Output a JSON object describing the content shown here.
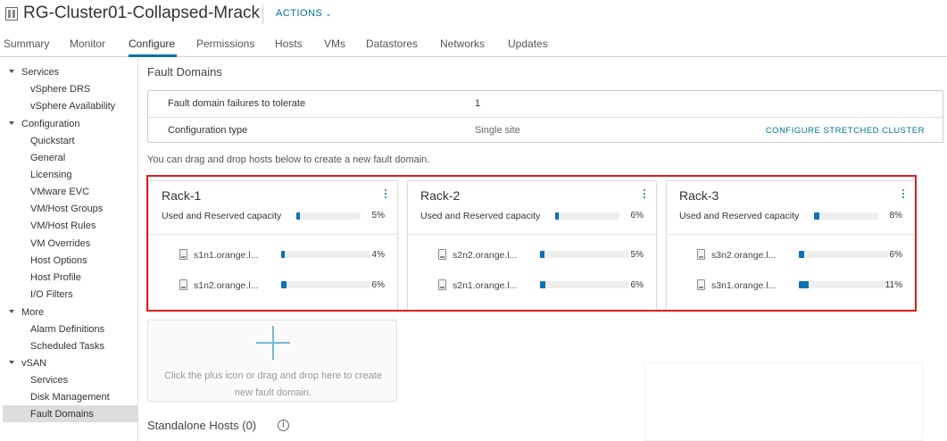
{
  "header": {
    "title": "RG-Cluster01-Collapsed-Mrack",
    "actions_label": "ACTIONS",
    "icon": "cluster-icon"
  },
  "tabs": [
    {
      "label": "Summary"
    },
    {
      "label": "Monitor"
    },
    {
      "label": "Configure",
      "active": true
    },
    {
      "label": "Permissions"
    },
    {
      "label": "Hosts"
    },
    {
      "label": "VMs"
    },
    {
      "label": "Datastores"
    },
    {
      "label": "Networks"
    },
    {
      "label": "Updates"
    }
  ],
  "sidebar": {
    "groups": [
      {
        "label": "Services",
        "items": [
          "vSphere DRS",
          "vSphere Availability"
        ]
      },
      {
        "label": "Configuration",
        "items": [
          "Quickstart",
          "General",
          "Licensing",
          "VMware EVC",
          "VM/Host Groups",
          "VM/Host Rules",
          "VM Overrides",
          "Host Options",
          "Host Profile",
          "I/O Filters"
        ]
      },
      {
        "label": "More",
        "items": [
          "Alarm Definitions",
          "Scheduled Tasks"
        ]
      },
      {
        "label": "vSAN",
        "items": [
          "Services",
          "Disk Management",
          "Fault Domains"
        ]
      }
    ],
    "selected": "Fault Domains"
  },
  "main": {
    "title": "Fault Domains",
    "summary": [
      {
        "label": "Fault domain failures to tolerate",
        "value": "1"
      },
      {
        "label": "Configuration type",
        "value": "Single site",
        "link": "CONFIGURE STRETCHED CLUSTER"
      }
    ],
    "help_text": "You can drag and drop hosts below to create a new fault domain.",
    "capacity_label": "Used and Reserved capacity",
    "racks": [
      {
        "name": "Rack-1",
        "capacity_pct": 5,
        "capacity_text": "5%",
        "hosts": [
          {
            "name": "s1n1.orange.l...",
            "pct": 4,
            "pct_text": "4%"
          },
          {
            "name": "s1n2.orange.l...",
            "pct": 6,
            "pct_text": "6%"
          }
        ]
      },
      {
        "name": "Rack-2",
        "capacity_pct": 6,
        "capacity_text": "6%",
        "hosts": [
          {
            "name": "s2n2.orange.l...",
            "pct": 5,
            "pct_text": "5%"
          },
          {
            "name": "s2n1.orange.l...",
            "pct": 6,
            "pct_text": "6%"
          }
        ]
      },
      {
        "name": "Rack-3",
        "capacity_pct": 8,
        "capacity_text": "8%",
        "hosts": [
          {
            "name": "s3n2.orange.l...",
            "pct": 6,
            "pct_text": "6%"
          },
          {
            "name": "s3n1.orange.l...",
            "pct": 11,
            "pct_text": "11%"
          }
        ]
      }
    ],
    "new_fault_domain_text": "Click the plus icon or drag and drop here to create new fault domain.",
    "standalone_title": "Standalone Hosts (0)",
    "colors": {
      "accent": "#0072a3",
      "bar": "#0a72b5",
      "highlight": "#d9201d"
    }
  }
}
